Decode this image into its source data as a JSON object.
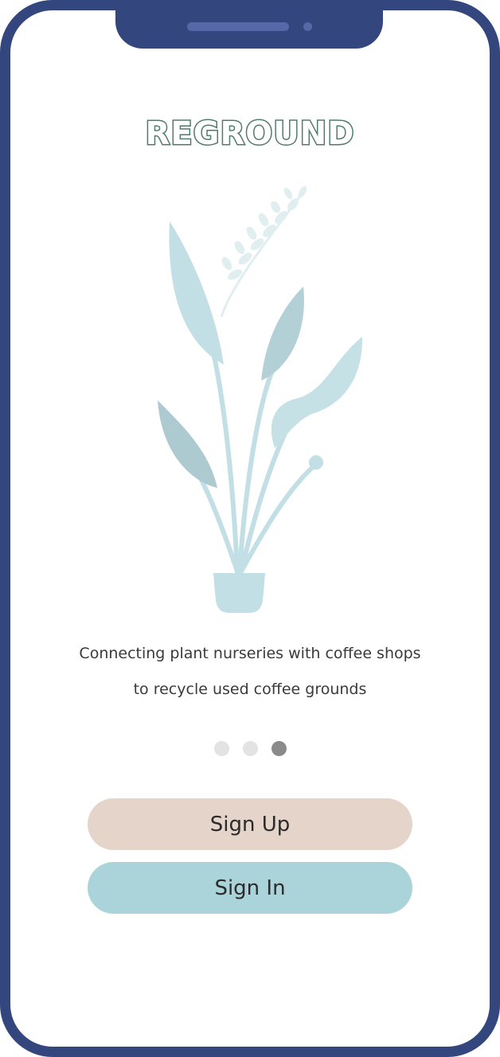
{
  "app": {
    "logo_text": "REGROUND",
    "tagline_line1": "Connecting plant nurseries with coffee shops",
    "tagline_line2": "to recycle used coffee grounds"
  },
  "carousel": {
    "dot_count": 3,
    "active_index": 2
  },
  "buttons": {
    "sign_up_label": "Sign Up",
    "sign_in_label": "Sign In"
  },
  "colors": {
    "frame": "#34467e",
    "logo_outline": "#4f7a6d",
    "sign_up_bg": "#e5d4ca",
    "sign_in_bg": "#abd4da",
    "plant_leaf": "#c1dfe4",
    "plant_leaf_dark": "#adcad1",
    "dot_inactive": "#e3e3e3",
    "dot_active": "#8a8a8a"
  },
  "icons": {
    "illustration": "potted-plant-illustration"
  }
}
